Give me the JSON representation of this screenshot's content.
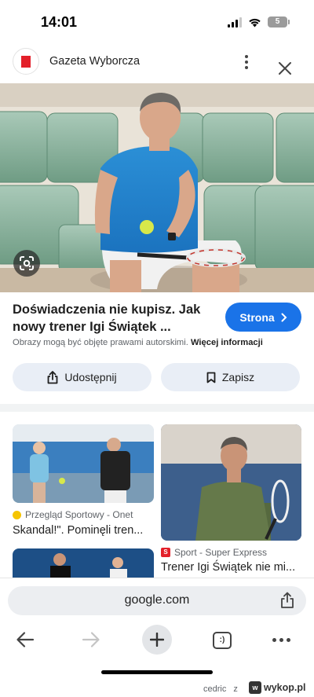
{
  "status_bar": {
    "time": "14:01",
    "battery_level": "5",
    "icons": [
      "signal-icon",
      "wifi-icon",
      "battery-icon"
    ]
  },
  "header": {
    "site_name": "Gazeta Wyborcza",
    "icons": [
      "site-logo-icon",
      "more-vert-icon",
      "close-icon"
    ],
    "logo_color": "#e3202a"
  },
  "result": {
    "title_line1": "Doświadczenia nie kupisz. Jak",
    "title_line2": "nowy trener Igi Świątek ...",
    "visit_label": "Strona",
    "copyright_text": "Obrazy mogą być objęte prawami autorskimi.",
    "copyright_link": "Więcej informacji",
    "share_label": "Udostępnij",
    "save_label": "Zapisz",
    "accent_color": "#1a73e8"
  },
  "related": [
    {
      "source": "Przegląd Sportowy - Onet",
      "title": "Skandal!\". Pominęli tren..."
    },
    {
      "source": "Sport - Super Express",
      "title": "Trener Igi Świątek nie mi..."
    }
  ],
  "browser": {
    "url": "google.com",
    "tabs_label": ":)"
  },
  "watermark": {
    "user": "cedric",
    "separator": "z",
    "brand": "wykop.pl"
  }
}
